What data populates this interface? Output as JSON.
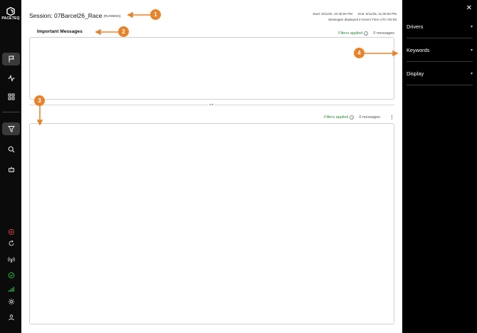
{
  "app": {
    "brand": "PACETEQ"
  },
  "session": {
    "title": "Session: 07Barcel26_Race",
    "status": "(RUNNING)",
    "start": "Start: 6/11/26, 10:45:00 PM",
    "end": "End: 6/11/26, 11:00:00 PM",
    "timezone_note": "Messages displayed in Event Time UTC+02:00"
  },
  "important_panel": {
    "label": "Important Messages",
    "filters_label": "Filters applied",
    "count": "0 messages"
  },
  "messages_panel": {
    "filters_label": "Filters applied",
    "count": "0 messages",
    "menu_glyph": "⋮"
  },
  "drawer": {
    "close_glyph": "✕",
    "sections": [
      {
        "label": "Drivers"
      },
      {
        "label": "Keywords"
      },
      {
        "label": "Display"
      }
    ]
  },
  "annotations": {
    "callouts": [
      "1",
      "2",
      "3",
      "4"
    ]
  },
  "colors": {
    "sidebar_bg": "#0b0b0b",
    "drawer_bg": "#000000",
    "accent_orange": "#e8832a",
    "filter_green": "#2e8b3a",
    "status_red": "#d13b3b",
    "status_green": "#2fb34a"
  },
  "icons": {
    "sidebar_top": [
      "flag-icon",
      "activity-icon",
      "grid-icon"
    ],
    "sidebar_mid": [
      "filter-icon",
      "search-icon",
      "robot-icon"
    ],
    "sidebar_bottom": [
      "record-icon",
      "refresh-icon",
      "broadcast-icon",
      "check-circle-icon",
      "signal-bars-icon",
      "gear-icon",
      "user-icon"
    ]
  }
}
